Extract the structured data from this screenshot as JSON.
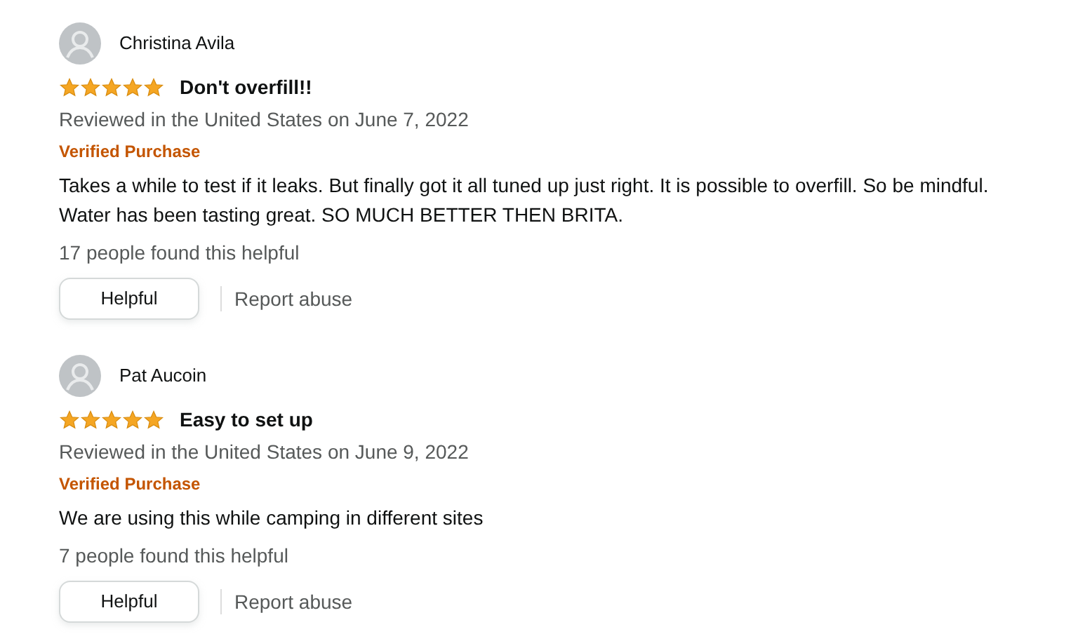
{
  "reviews": [
    {
      "reviewer": "Christina Avila",
      "stars": 5,
      "title": "Don't overfill!!",
      "date": "Reviewed in the United States on June 7, 2022",
      "badge": "Verified Purchase",
      "body": "Takes a while to test if it leaks. But finally got it all tuned up just right. It is possible to overfill. So be mindful. Water has been tasting great. SO MUCH BETTER THEN BRITA.",
      "helpful_count": "17 people found this helpful",
      "helpful_button": "Helpful",
      "report": "Report abuse"
    },
    {
      "reviewer": "Pat Aucoin",
      "stars": 5,
      "title": "Easy to set up",
      "date": "Reviewed in the United States on June 9, 2022",
      "badge": "Verified Purchase",
      "body": "We are using this while camping in different sites",
      "helpful_count": "7 people found this helpful",
      "helpful_button": "Helpful",
      "report": "Report abuse"
    }
  ]
}
